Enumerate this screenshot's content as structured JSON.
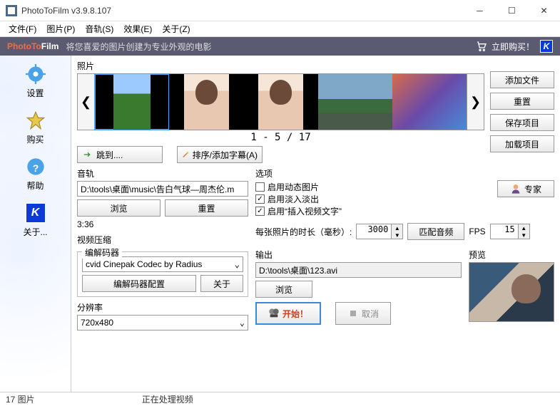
{
  "window": {
    "title": "PhotoToFilm v3.9.8.107"
  },
  "menubar": [
    "文件(F)",
    "图片(P)",
    "音轨(S)",
    "效果(E)",
    "关于(Z)"
  ],
  "banner": {
    "brand1": "PhotoTo",
    "brand2": "Film",
    "slogan": "将您喜爱的图片创建为专业外观的电影",
    "buy": "立即购买！"
  },
  "sidebar": [
    {
      "label": "设置",
      "icon": "gear"
    },
    {
      "label": "购买",
      "icon": "star"
    },
    {
      "label": "帮助",
      "icon": "help"
    },
    {
      "label": "关于...",
      "icon": "klogo"
    }
  ],
  "photos": {
    "label": "照片",
    "counter": "1 - 5 / 17",
    "actions": [
      "添加文件",
      "重置",
      "保存项目",
      "加载项目"
    ],
    "jump": "跳到....",
    "sort": "排序/添加字幕(A)"
  },
  "audio": {
    "label": "音轨",
    "path": "D:\\tools\\桌面\\music\\告白气球—周杰伦.m",
    "browse": "浏览",
    "reset": "重置",
    "duration": "3:36"
  },
  "vcomp": {
    "label": "视频压缩",
    "codec_label": "编解码器",
    "codec": "cvid Cinepak Codec by Radius",
    "config": "编解码器配置",
    "about": "关于"
  },
  "res": {
    "label": "分辨率",
    "value": "720x480"
  },
  "options": {
    "label": "选项",
    "opt1": {
      "text": "启用动态图片",
      "checked": false
    },
    "opt2": {
      "text": "启用淡入淡出",
      "checked": true
    },
    "opt3": {
      "text": "启用“插入视频文字”",
      "checked": true
    },
    "duration_label": "每张照片的时长（毫秒）:",
    "duration": "3000",
    "match_audio": "匹配音频",
    "fps_label": "FPS",
    "fps": "15",
    "expert": "专家"
  },
  "output": {
    "label": "输出",
    "path": "D:\\tools\\桌面\\123.avi",
    "browse": "浏览",
    "preview_label": "预览",
    "start": "开始！",
    "cancel": "取消"
  },
  "statusbar": {
    "left": "17 图片",
    "right": "正在处理视频"
  }
}
